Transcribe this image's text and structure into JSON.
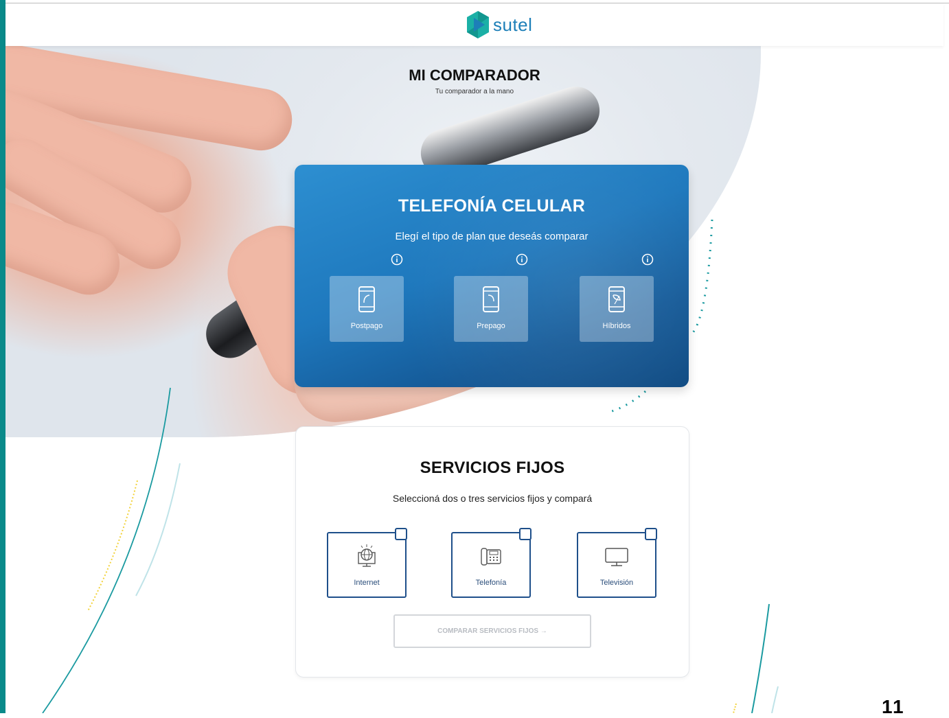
{
  "brand": {
    "name": "sutel",
    "accent": "#1d7fb8",
    "teal": "#0a8a8a"
  },
  "hero": {
    "title": "MI COMPARADOR",
    "subtitle": "Tu comparador a la mano"
  },
  "celular": {
    "title": "TELEFONÍA CELULAR",
    "subtitle": "Elegí el tipo de plan que deseás comparar",
    "plans": [
      {
        "label": "Postpago",
        "icon": "phone-postpago-icon"
      },
      {
        "label": "Prepago",
        "icon": "phone-prepago-icon"
      },
      {
        "label": "Híbridos",
        "icon": "phone-hibridos-icon"
      }
    ]
  },
  "fijos": {
    "title": "SERVICIOS FIJOS",
    "subtitle": "Seleccioná dos o tres servicios fijos y compará",
    "services": [
      {
        "label": "Internet",
        "icon": "globe-computer-icon"
      },
      {
        "label": "Telefonía",
        "icon": "desk-phone-icon"
      },
      {
        "label": "Televisión",
        "icon": "monitor-icon"
      }
    ],
    "compare_label": "COMPARAR SERVICIOS FIJOS →"
  },
  "page_number": "11"
}
